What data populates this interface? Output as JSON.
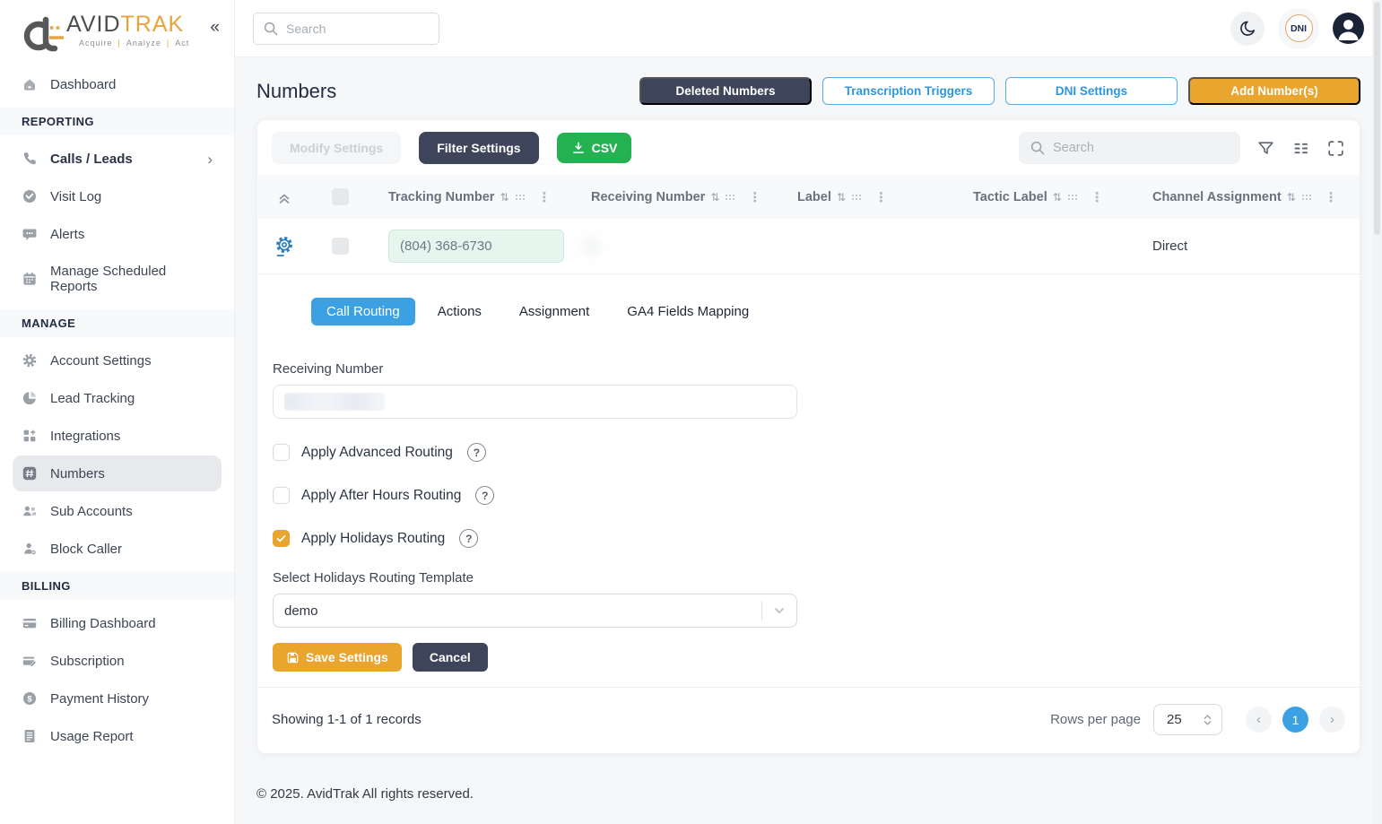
{
  "logo": {
    "brand_avid": "AVID",
    "brand_trak": "TRAK",
    "tagline_acquire": "Acquire",
    "tagline_analyze": "Analyze",
    "tagline_act": "Act",
    "tagline_sep": "|"
  },
  "icons": {
    "collapse": "«",
    "chevron_right": "›",
    "sort": "⇅",
    "kebab": "⋮",
    "question": "?",
    "prev": "‹",
    "next": "›"
  },
  "topbar": {
    "search_placeholder": "Search",
    "dni_badge": "DNI"
  },
  "sidebar": {
    "dashboard": "Dashboard",
    "reporting_header": "REPORTING",
    "reporting": [
      "Calls / Leads",
      "Visit Log",
      "Alerts",
      "Manage Scheduled Reports"
    ],
    "manage_header": "MANAGE",
    "manage": [
      "Account Settings",
      "Lead Tracking",
      "Integrations",
      "Numbers",
      "Sub Accounts",
      "Block Caller"
    ],
    "billing_header": "BILLING",
    "billing": [
      "Billing Dashboard",
      "Subscription",
      "Payment History",
      "Usage Report"
    ]
  },
  "page": {
    "title": "Numbers",
    "buttons": {
      "deleted_numbers": "Deleted Numbers",
      "transcription_triggers": "Transcription Triggers",
      "dni_settings": "DNI Settings",
      "add_numbers": "Add Number(s)"
    }
  },
  "toolbar": {
    "modify_settings": "Modify Settings",
    "filter_settings": "Filter Settings",
    "csv": "CSV",
    "search_placeholder": "Search"
  },
  "table": {
    "columns": [
      "Tracking Number",
      "Receiving Number",
      "Label",
      "Tactic Label",
      "Channel Assignment"
    ],
    "row": {
      "tracking_number": "(804) 368-6730",
      "channel_assignment": "Direct"
    }
  },
  "detail": {
    "tabs": [
      "Call Routing",
      "Actions",
      "Assignment",
      "GA4 Fields Mapping"
    ],
    "receiving_number_label": "Receiving Number",
    "checkboxes": [
      {
        "label": "Apply Advanced Routing",
        "checked": false
      },
      {
        "label": "Apply After Hours Routing",
        "checked": false
      },
      {
        "label": "Apply Holidays Routing",
        "checked": true
      }
    ],
    "template_label": "Select Holidays Routing Template",
    "template_value": "demo",
    "save_label": "Save Settings",
    "cancel_label": "Cancel"
  },
  "footer": {
    "showing": "Showing 1-1 of 1 records",
    "rows_per_page_label": "Rows per page",
    "rows_per_page_value": "25",
    "current_page": "1"
  },
  "copyright": "© 2025. AvidTrak All rights reserved.",
  "colors": {
    "accent_orange": "#EAA52F",
    "accent_blue": "#3BA1E3",
    "dark_slate": "#3E455B",
    "csv_green": "#23B152",
    "navy": "#1B2337"
  }
}
